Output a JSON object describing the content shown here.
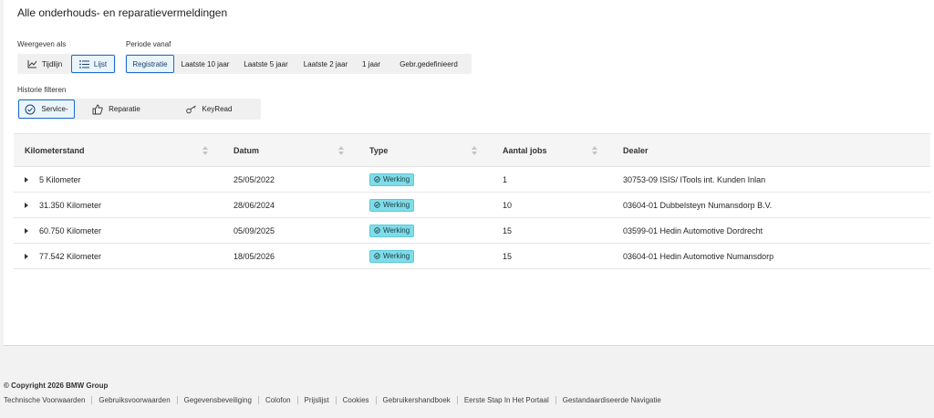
{
  "page": {
    "title": "Alle onderhouds- en reparatievermeldingen"
  },
  "view": {
    "label": "Weergeven als",
    "options": [
      {
        "label": "Tijdlijn",
        "icon": "line-chart-icon",
        "active": false
      },
      {
        "label": "Lijst",
        "icon": "list-icon",
        "active": true
      }
    ]
  },
  "period": {
    "label": "Periode vanaf",
    "options": [
      {
        "label": "Registratie",
        "active": true
      },
      {
        "label": "Laatste 10 jaar",
        "active": false
      },
      {
        "label": "Laatste 5 jaar",
        "active": false
      },
      {
        "label": "Laatste 2 jaar",
        "active": false
      },
      {
        "label": "1 jaar",
        "active": false
      },
      {
        "label": "Gebr.gedefinieerd",
        "active": false
      }
    ]
  },
  "filter": {
    "label": "Historie filteren",
    "options": [
      {
        "label": "Service-",
        "icon": "service-gear-icon",
        "active": true
      },
      {
        "label": "Reparatie",
        "icon": "thumbs-up-icon",
        "active": false
      },
      {
        "label": "KeyRead",
        "icon": "key-icon",
        "active": false
      }
    ]
  },
  "table": {
    "columns": [
      "Kilometerstand",
      "Datum",
      "Type",
      "Aantal jobs",
      "Dealer"
    ],
    "rows": [
      {
        "km": "5 Kilometer",
        "date": "25/05/2022",
        "type": "Werking",
        "jobs": "1",
        "dealer": "30753-09 ISIS/ ITools int. Kunden Inlan"
      },
      {
        "km": "31.350 Kilometer",
        "date": "28/06/2024",
        "type": "Werking",
        "jobs": "10",
        "dealer": "03604-01 Dubbelsteyn Numansdorp B.V."
      },
      {
        "km": "60.750 Kilometer",
        "date": "05/09/2025",
        "type": "Werking",
        "jobs": "15",
        "dealer": "03599-01 Hedin Automotive Dordrecht"
      },
      {
        "km": "77.542 Kilometer",
        "date": "18/05/2026",
        "type": "Werking",
        "jobs": "15",
        "dealer": "03604-01 Hedin Automotive Numansdorp"
      }
    ]
  },
  "footer": {
    "copyright": "© Copyright 2026 BMW Group",
    "links": [
      "Technische Voorwaarden",
      "Gebruiksvoorwaarden",
      "Gegevensbeveiliging",
      "Colofon",
      "Prijslijst",
      "Cookies",
      "Gebruikershandboek",
      "Eerste Stap In Het Portaal",
      "Gestandaardiseerde Navigatie"
    ]
  },
  "colors": {
    "accent": "#1c69d4",
    "badge": "#7fdce8",
    "active_bg": "#eaf5fb"
  }
}
